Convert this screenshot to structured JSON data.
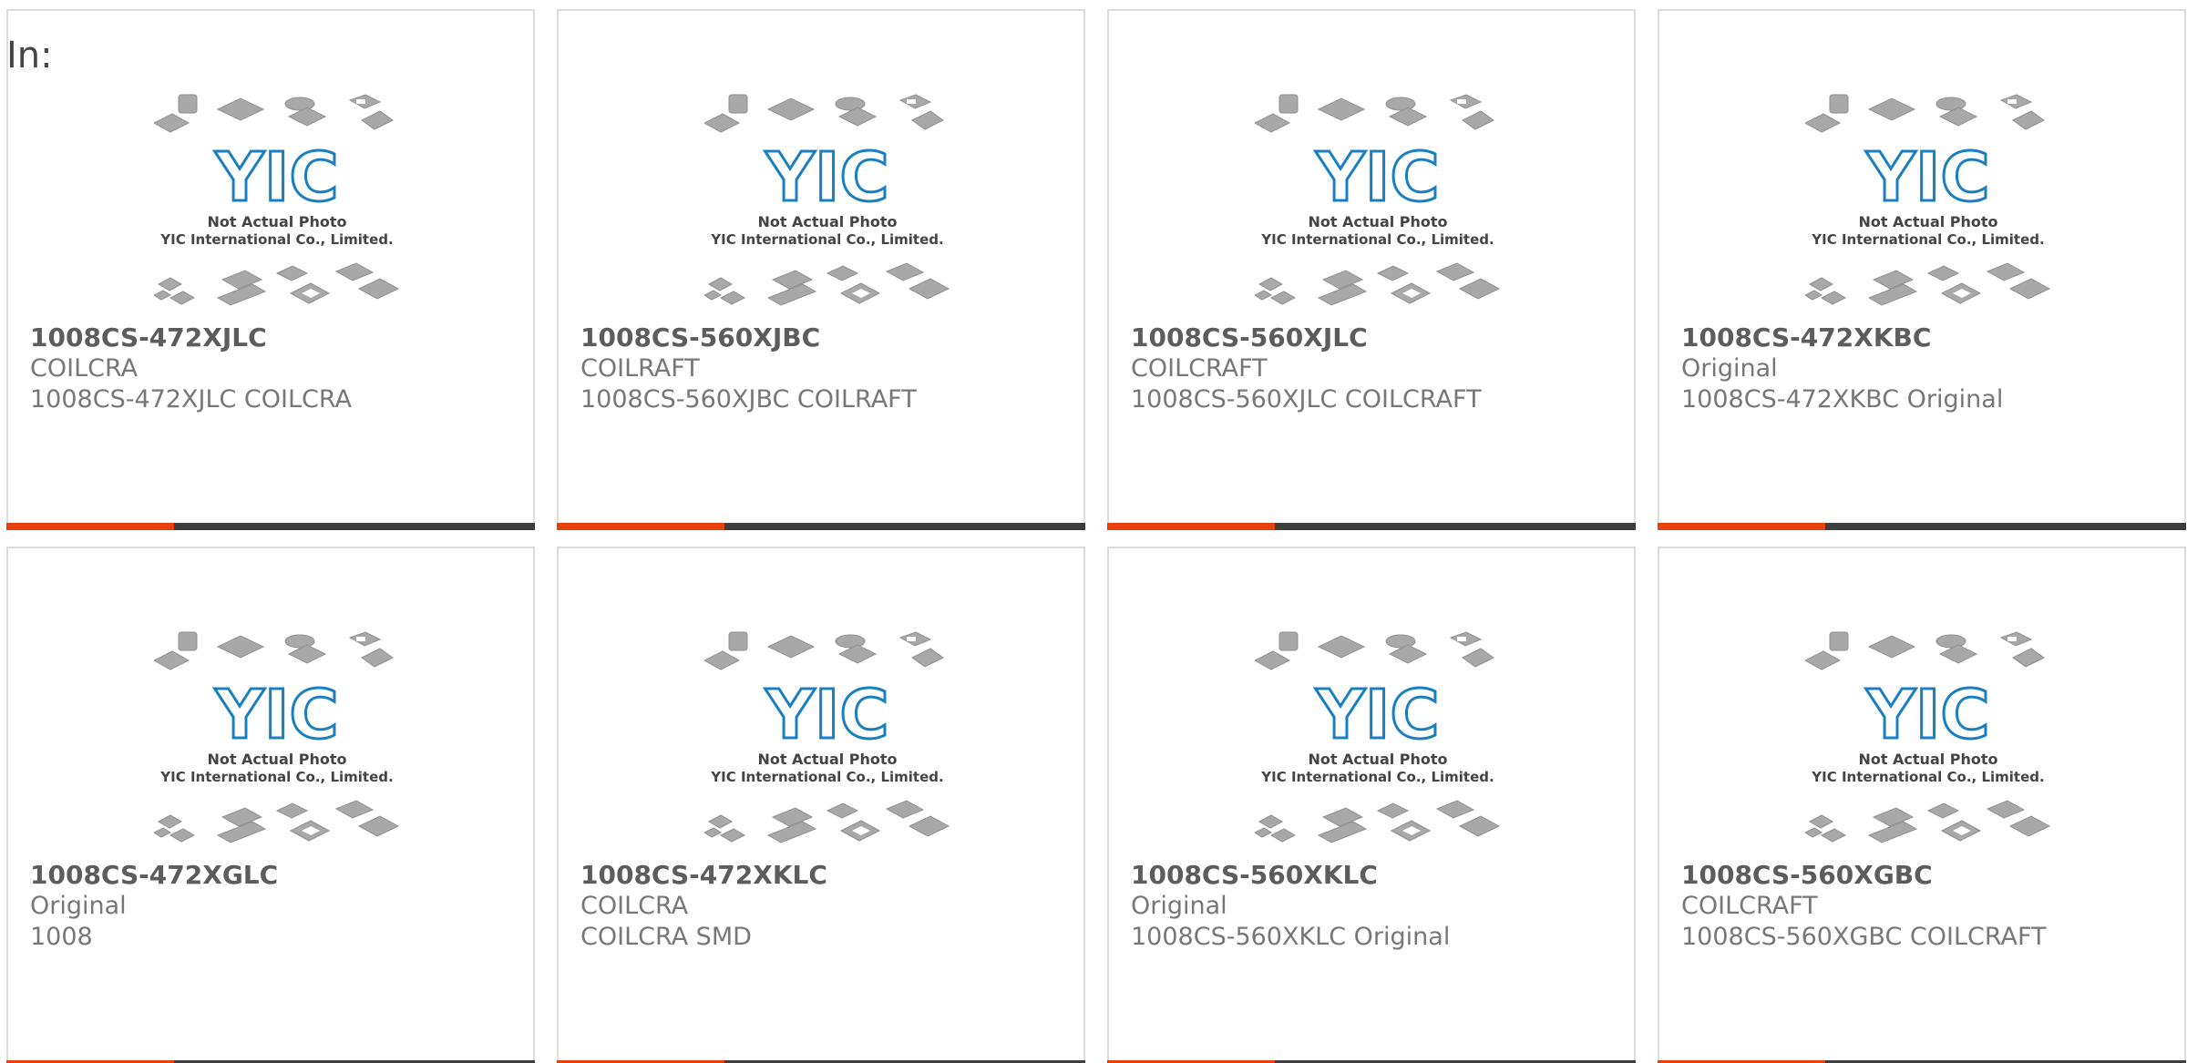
{
  "header": {
    "label": "In:"
  },
  "colors": {
    "accent": "#e8400c",
    "bar": "#3d3d3d",
    "logo": "#1a7fc1",
    "chips": "#a8a8a8"
  },
  "placeholder": {
    "logo_text": "YIC",
    "line1": "Not Actual Photo",
    "line2": "YIC International Co., Limited."
  },
  "products": [
    {
      "part": "1008CS-472XJLC",
      "manufacturer": "COILCRA",
      "description": "1008CS-472XJLC COILCRA"
    },
    {
      "part": "1008CS-560XJBC",
      "manufacturer": "COILRAFT",
      "description": "1008CS-560XJBC COILRAFT"
    },
    {
      "part": "1008CS-560XJLC",
      "manufacturer": "COILCRAFT",
      "description": "1008CS-560XJLC COILCRAFT"
    },
    {
      "part": "1008CS-472XKBC",
      "manufacturer": "Original",
      "description": "1008CS-472XKBC Original"
    },
    {
      "part": "1008CS-472XGLC",
      "manufacturer": "Original",
      "description": "1008"
    },
    {
      "part": "1008CS-472XKLC",
      "manufacturer": "COILCRA",
      "description": "COILCRA SMD"
    },
    {
      "part": "1008CS-560XKLC",
      "manufacturer": "Original",
      "description": "1008CS-560XKLC Original"
    },
    {
      "part": "1008CS-560XGBC",
      "manufacturer": "COILCRAFT",
      "description": "1008CS-560XGBC COILCRAFT"
    }
  ]
}
